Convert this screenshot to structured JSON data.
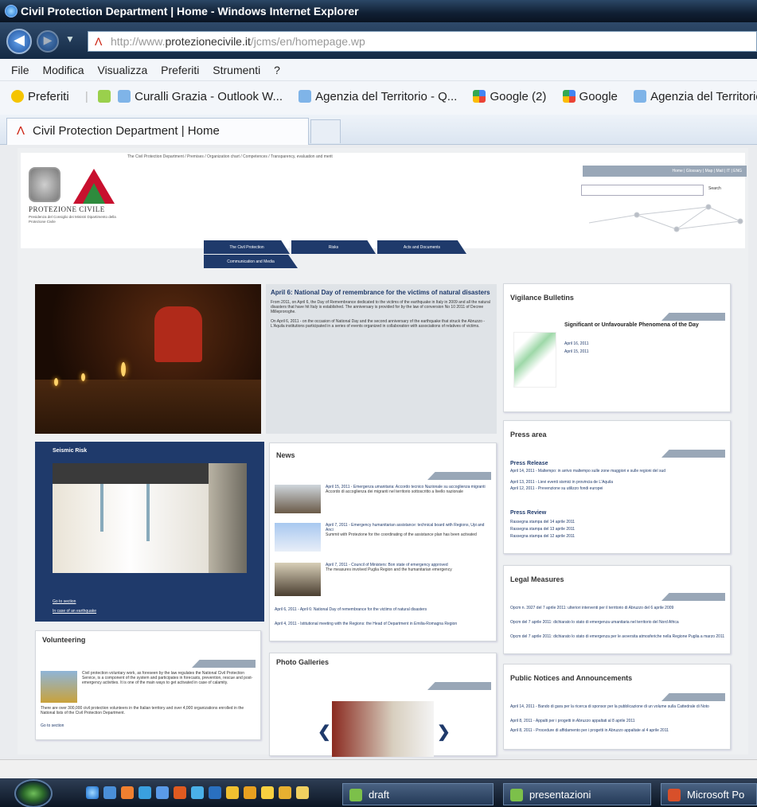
{
  "window": {
    "title": "Civil Protection Department | Home - Windows Internet Explorer"
  },
  "address": {
    "prefix": "http://www.",
    "domain": "protezionecivile.it",
    "path": "/jcms/en/homepage.wp"
  },
  "menu": [
    "File",
    "Modifica",
    "Visualizza",
    "Preferiti",
    "Strumenti",
    "?"
  ],
  "favorites": {
    "label": "Preferiti",
    "items": [
      "Curalli Grazia - Outlook W...",
      "Agenzia del Territorio - Q...",
      "Google (2)",
      "Google",
      "Agenzia del Territorio"
    ]
  },
  "tabs": [
    {
      "label": "Civil Protection Department | Home"
    }
  ],
  "site": {
    "breadcrumb": "The Civil Protection Department / Premises / Organization chart / Competences / Transparency, evaluation and merit",
    "logo_name": "PROTEZIONE CIVILE",
    "logo_sub": "Presidenza del Consiglio dei Ministri Dipartimento della Protezione Civile",
    "toplinks": "Home | Glossary | Map | Mail | IT | ENG",
    "search_btn": "Search",
    "nav": [
      "The Civil Protection",
      "Risks",
      "Acts and Documents",
      "Communication and Media"
    ]
  },
  "featured": {
    "title": "April 6: National Day of remembrance for the victims of natural disasters",
    "p1": "From 2011, on April 6, the Day of Remembrance dedicated to the victims of the earthquake in Italy in 2009 and all the natural disasters that have hit Italy is established. The anniversary is provided for by the law of conversion No 10 2011 of Decree Milleproroghe.",
    "p2": "On April 6, 2011 - on the occasion of National Day and the second anniversary of the earthquake that struck the Abruzzo - L'Aquila institutions participated in a series of events organized in collaboration with associations of relatives of victims."
  },
  "seismic": {
    "title": "Seismic Risk",
    "link1": "Go to section",
    "link2": "In case of an earthquake"
  },
  "volunteering": {
    "title": "Volunteering",
    "text": "Civil protection voluntary work, as foreseen by the law regulates the National Civil Protection Service, is a component of the system and participates in forecasts, prevention, rescue and post-emergency activities. It is one of the main ways to get activated in case of calamity.",
    "text2": "There are over 300,000 civil protection volunteers in the Italian territory and over 4,000 organizations enrolled in the National lists of the Civil Protection Department.",
    "link": "Go to section"
  },
  "news": {
    "title": "News",
    "items": [
      {
        "head": "April 15, 2011 - Emergenza umanitaria: Accordo tecnico Nazionale su accoglienza migranti",
        "body": "Accordo di accoglienza dei migranti nel territorio sottoscritto a livello nazionale"
      },
      {
        "head": "April 7, 2011 - Emergency humanitarian assistance: technical board with Regions, Upi and Anci",
        "body": "Summit with Protezione for the coordinating of the assistance plan has been activated"
      },
      {
        "head": "April 7, 2011 - Council of Ministers: Bon state of emergency approved",
        "body": "The measures involved Puglia Region and the humanitarian emergency"
      }
    ],
    "links": [
      "April 6, 2011 - April 6: National Day of remembrance for the victims of natural disasters",
      "April 4, 2011 - Istitutional meeting with the Regions: the Head of Department in Emilia-Romagna Region"
    ]
  },
  "photo": {
    "title": "Photo Galleries"
  },
  "vigilance": {
    "title": "Vigilance Bulletins",
    "sub": "Significant or Unfavourable Phenomena of the Day",
    "dates": [
      "April 16, 2011",
      "April 15, 2011"
    ]
  },
  "press": {
    "title": "Press area",
    "release_title": "Press Release",
    "releases": [
      "April 14, 2011 - Maltempo: in arrivo maltempo sulle zone maggiori e sulle regioni del sud",
      "April 13, 2011 - Lievi eventi sismici in provincia de L'Aquila",
      "April 12, 2011 - Prevenzione su utilizzo fondi europei"
    ],
    "review_title": "Press Review",
    "reviews": [
      "Rassegna stampa del 14 aprile 2011",
      "Rassegna stampa del 13 aprile 2011",
      "Rassegna stampa del 12 aprile 2011"
    ]
  },
  "legal": {
    "title": "Legal Measures",
    "items": [
      "Opcm n. 3927 del 7 aprile 2011: ulteriori interventi per il territorio di Abruzzo del 6 aprile 2009",
      "Opcm del 7 aprile 2011: dichiarato lo stato di emergenza umanitaria nel territorio del Nord Africa",
      "Opcm del 7 aprile 2011: dichiarato lo stato di emergenza per le avversita atmosferiche nella Regione Puglia a marzo 2011"
    ]
  },
  "notices": {
    "title": "Public Notices and Announcements",
    "items": [
      "April 14, 2011 - Bando di gara per la ricerca di sponsor per la pubblicazione di un volume sulla Cattedrale di Noto",
      "April 8, 2011 - Appalti per i progetti in Abruzzo appaltati al 8 aprile 2011",
      "April 8, 2011 - Procedure di affidamento per i progetti in Abruzzo appaltate al 4 aprile 2011"
    ]
  },
  "taskbar": {
    "tasks": [
      "draft",
      "presentazioni",
      "Microsoft Po"
    ]
  }
}
